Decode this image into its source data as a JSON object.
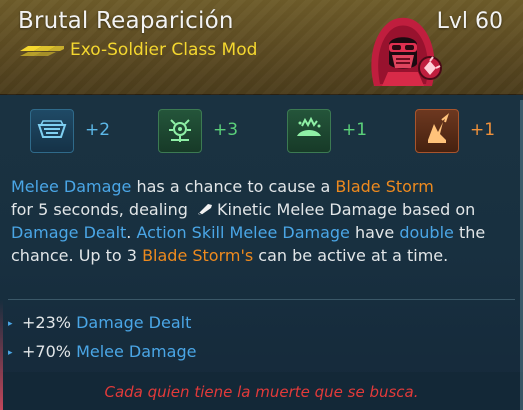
{
  "item": {
    "name": "Brutal Reaparición",
    "level": "Lvl 60",
    "type": "Exo-Soldier Class Mod",
    "rarity_color": "#f4d72f",
    "portrait_icon": "hooded-soldier-icon"
  },
  "stats": [
    {
      "icon": "blue-skill-icon",
      "value": "+2",
      "color": "#5cb8e8"
    },
    {
      "icon": "green-skill-icon",
      "value": "+3",
      "color": "#5bd07a"
    },
    {
      "icon": "green-skill-icon-2",
      "value": "+1",
      "color": "#5bd07a"
    },
    {
      "icon": "orange-skill-icon",
      "value": "+1",
      "color": "#f0913a"
    }
  ],
  "description": {
    "seg1": "Melee Damage",
    "seg2": " has a chance to cause a ",
    "seg3": "Blade Storm",
    "seg4": "for 5 seconds, dealing ",
    "seg5": "Kinetic Melee Damage",
    "seg6": " based on ",
    "seg7": "Damage Dealt",
    "seg8": ". ",
    "seg9": "Action Skill Melee Damage",
    "seg10": " have ",
    "seg11": "double",
    "seg12": " the chance. Up to 3 ",
    "seg13": "Blade Storm's",
    "seg14": " can be active at a time."
  },
  "bullets": [
    {
      "amount": "+23% ",
      "label": "Damage Dealt"
    },
    {
      "amount": "+70% ",
      "label": "Melee Damage"
    }
  ],
  "flavor": "Cada quien tiene la muerte que se busca.",
  "colors": {
    "keyword_blue": "#4aa6e6",
    "keyword_orange": "#ee8a1e",
    "flavor_red": "#e23a3a"
  }
}
